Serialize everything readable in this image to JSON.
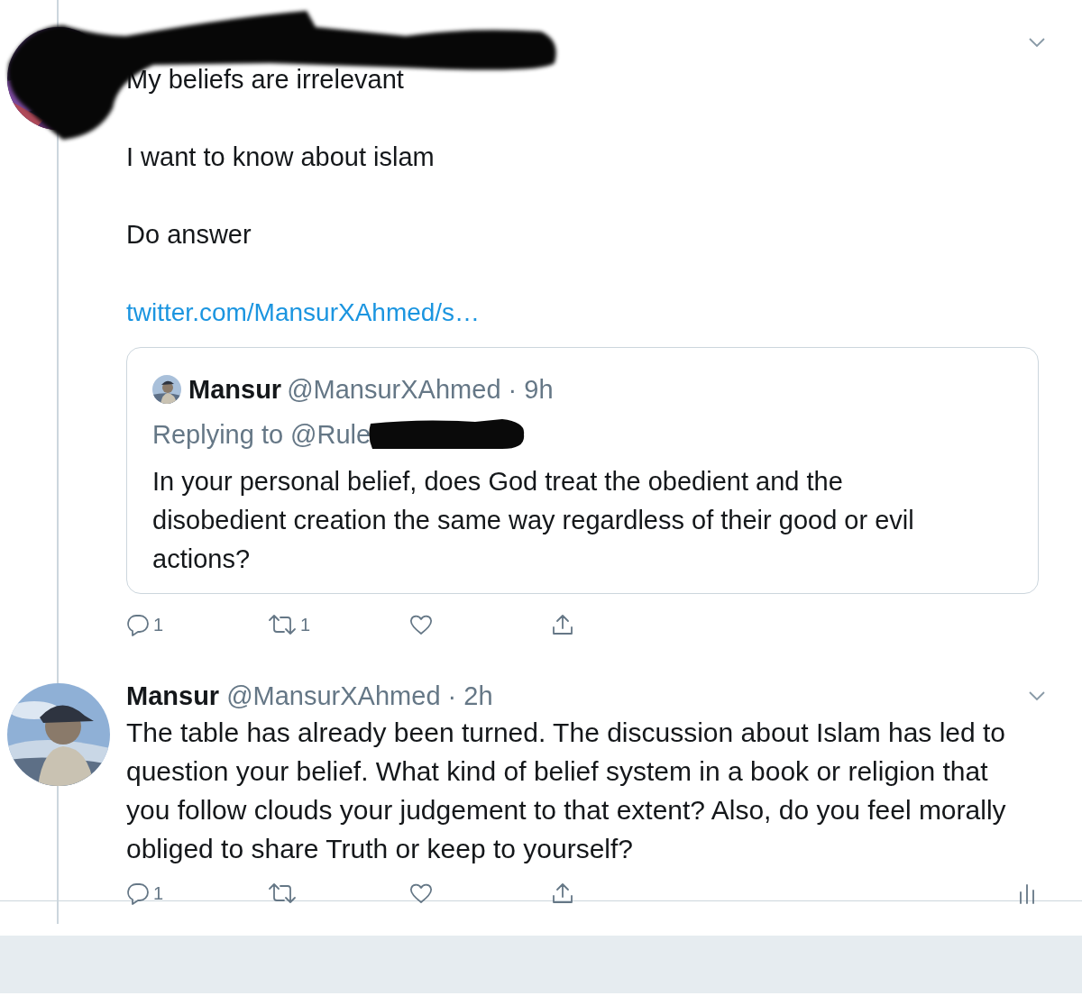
{
  "tweets": [
    {
      "avatar": {
        "kind": "picture"
      },
      "redacted_header": true,
      "paragraphs": [
        "My beliefs are irrelevant",
        "I want to know about islam",
        "Do answer"
      ],
      "link": "twitter.com/MansurXAhmed/s…",
      "quote": {
        "name": "Mansur",
        "meta": "@MansurXAhmed · 9h",
        "replying_label": "Replying to",
        "replying_handle": "@Rule",
        "replying_redacted": true,
        "body": "In your personal belief, does God treat the obedient and the disobedient creation the same way regardless of their good or evil actions?"
      },
      "actions": [
        {
          "kind": "reply",
          "count": "1"
        },
        {
          "kind": "retweet",
          "count": "1"
        },
        {
          "kind": "like"
        },
        {
          "kind": "share"
        }
      ]
    },
    {
      "avatar": {
        "kind": "picture"
      },
      "redacted_header": false,
      "name": "Mansur",
      "meta": "@MansurXAhmed · 2h",
      "paragraphs": [
        "The table has already been turned. The discussion about Islam has led to question your belief. What kind of belief system in a book or religion that you follow clouds your judgement to that extent? Also, do you feel morally obliged to share Truth or keep to yourself?"
      ],
      "actions": [
        {
          "kind": "reply",
          "count": "1"
        },
        {
          "kind": "retweet"
        },
        {
          "kind": "like"
        },
        {
          "kind": "share"
        },
        {
          "kind": "analytics"
        }
      ]
    }
  ]
}
